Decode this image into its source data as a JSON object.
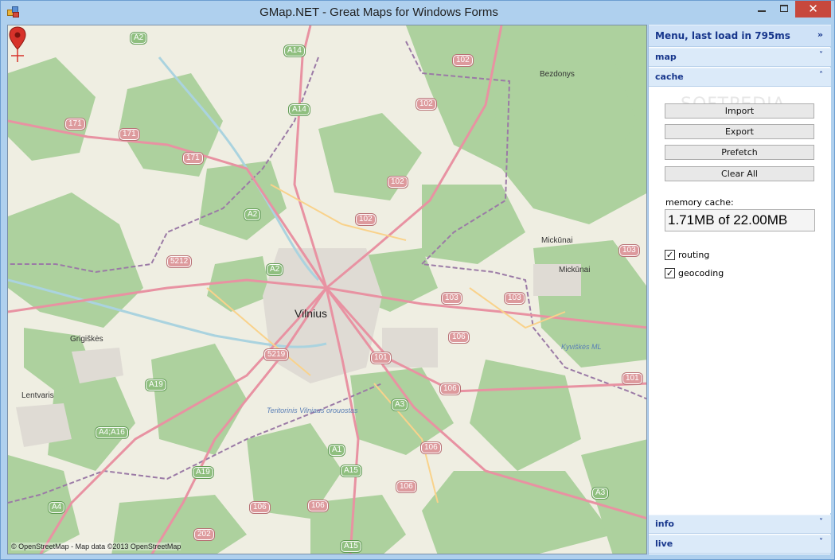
{
  "window": {
    "title": "GMap.NET - Great Maps for Windows Forms",
    "close_glyph": "✕"
  },
  "map": {
    "city_label": "Vilnius",
    "attribution": "© OpenStreetMap - Map data ©2013 OpenStreetMap",
    "places": [
      {
        "name": "Bezdonys"
      },
      {
        "name": "Mickūnai"
      },
      {
        "name": "Mickūnai"
      },
      {
        "name": "Grigiškės"
      },
      {
        "name": "Lentvaris"
      },
      {
        "name": "Kyviškės ML"
      },
      {
        "name": "Teritorinis Vilniaus orouostas"
      }
    ],
    "road_shields": [
      "A2",
      "A14",
      "102",
      "102",
      "171",
      "171",
      "A14",
      "171",
      "102",
      "A2",
      "102",
      "5212",
      "A2",
      "103",
      "103",
      "103",
      "106",
      "101",
      "101",
      "5219",
      "A19",
      "A3",
      "106",
      "A4;A16",
      "A1",
      "106",
      "A19",
      "A15",
      "106",
      "A3",
      "A4",
      "106",
      "106",
      "202",
      "A15"
    ],
    "colors": {
      "land": "#efeee2",
      "forest": "#add19e",
      "urban": "#dfdbd4",
      "main_road": "#e892a2",
      "secondary_road": "#f9d28b",
      "water": "#aad3df",
      "boundary": "#9b7aa6",
      "marker": "#d7322a"
    }
  },
  "panel": {
    "menu_title": "Menu, last load in 795ms",
    "menu_arrow": "»",
    "sections": {
      "map": {
        "label": "map",
        "arrow": "˅"
      },
      "cache": {
        "label": "cache",
        "arrow": "˄"
      },
      "info": {
        "label": "info",
        "arrow": "˅"
      },
      "live": {
        "label": "live",
        "arrow": "˅"
      }
    },
    "cache": {
      "buttons": {
        "import": "Import",
        "export": "Export",
        "prefetch": "Prefetch",
        "clear_all": "Clear All"
      },
      "memory_label": "memory cache:",
      "memory_value": "1.71MB of 22.00MB",
      "routing_label": "routing",
      "routing_checked": true,
      "geocoding_label": "geocoding",
      "geocoding_checked": true,
      "watermark": "SOFTPEDIA"
    }
  }
}
